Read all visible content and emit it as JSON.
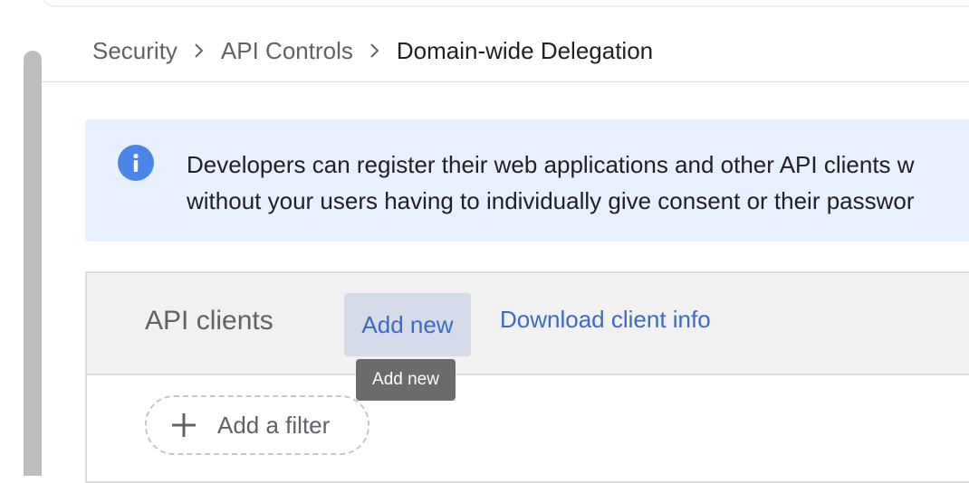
{
  "breadcrumb": {
    "items": [
      "Security",
      "API Controls"
    ],
    "current": "Domain-wide Delegation"
  },
  "info": {
    "icon": "info-icon",
    "line1": "Developers can register their web applications and other API clients w",
    "line2": "without your users having to individually give consent or their passwor"
  },
  "api_clients": {
    "title": "API clients",
    "add_new_label": "Add new",
    "download_label": "Download client info",
    "tooltip": "Add new",
    "filter_label": "Add a filter"
  },
  "colors": {
    "accent": "#3c6ac9",
    "info_icon": "#4a86e8",
    "banner_bg": "#e8f0fe"
  }
}
